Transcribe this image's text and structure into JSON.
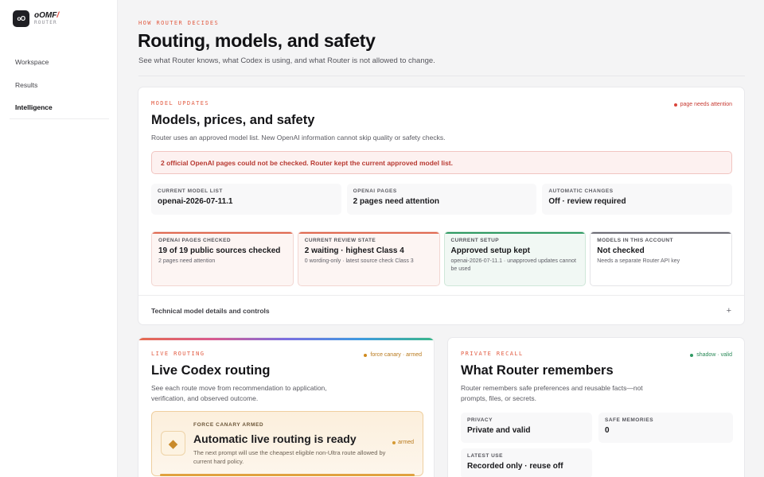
{
  "brand": {
    "mark": "oO",
    "name": "oOMF",
    "name_accent": "/",
    "sub": "ROUTER"
  },
  "nav": [
    {
      "label": "Workspace"
    },
    {
      "label": "Results"
    },
    {
      "label": "Intelligence"
    }
  ],
  "page": {
    "eyebrow": "HOW ROUTER DECIDES",
    "title": "Routing, models, and safety",
    "subtitle": "See what Router knows, what Codex is using, and what Router is not allowed to change."
  },
  "models_card": {
    "eyebrow": "MODEL UPDATES",
    "title": "Models, prices, and safety",
    "subtitle": "Router uses an approved model list. New OpenAI information cannot skip quality or safety checks.",
    "status": {
      "label": "page needs attention",
      "color": "#d9443a"
    },
    "alert": "2 official OpenAI pages could not be checked. Router kept the current approved model list.",
    "stats": [
      {
        "label": "CURRENT MODEL LIST",
        "value": "openai-2026-07-11.1"
      },
      {
        "label": "OPENAI PAGES",
        "value": "2 pages need attention"
      },
      {
        "label": "AUTOMATIC CHANGES",
        "value": "Off · review required"
      }
    ],
    "tiles": [
      {
        "label": "OPENAI PAGES CHECKED",
        "value": "19 of 19 public sources checked",
        "note": "2 pages need attention",
        "tone": "red"
      },
      {
        "label": "CURRENT REVIEW STATE",
        "value": "2 waiting · highest Class 4",
        "note": "0 wording-only · latest source check Class 3",
        "tone": "red"
      },
      {
        "label": "CURRENT SETUP",
        "value": "Approved setup kept",
        "note": "openai-2026-07-11.1 · unapproved updates cannot be used",
        "tone": "green"
      },
      {
        "label": "MODELS IN THIS ACCOUNT",
        "value": "Not checked",
        "note": "Needs a separate Router API key",
        "tone": "grey"
      }
    ],
    "details_label": "Technical model details and controls",
    "details_icon": "+"
  },
  "routing_card": {
    "eyebrow": "LIVE ROUTING",
    "title": "Live Codex routing",
    "subtitle": "See each route move from recommendation to application, verification, and observed outcome.",
    "status": {
      "label": "force canary · armed",
      "color": "#d08a1e"
    },
    "armed": {
      "icon": "diamond-icon",
      "eyebrow": "FORCE CANARY ARMED",
      "title": "Automatic live routing is ready",
      "subtitle": "The next prompt will use the cheapest eligible non-Ultra route allowed by current hard policy.",
      "pill": "armed"
    }
  },
  "recall_card": {
    "eyebrow": "PRIVATE RECALL",
    "title": "What Router remembers",
    "subtitle": "Router remembers safe preferences and reusable facts—not prompts, files, or secrets.",
    "status": {
      "label": "shadow · valid",
      "color": "#2f9a63"
    },
    "items": [
      {
        "label": "PRIVACY",
        "value": "Private and valid"
      },
      {
        "label": "SAFE MEMORIES",
        "value": "0"
      },
      {
        "label": "LATEST USE",
        "value": "Recorded only · reuse off"
      }
    ]
  }
}
